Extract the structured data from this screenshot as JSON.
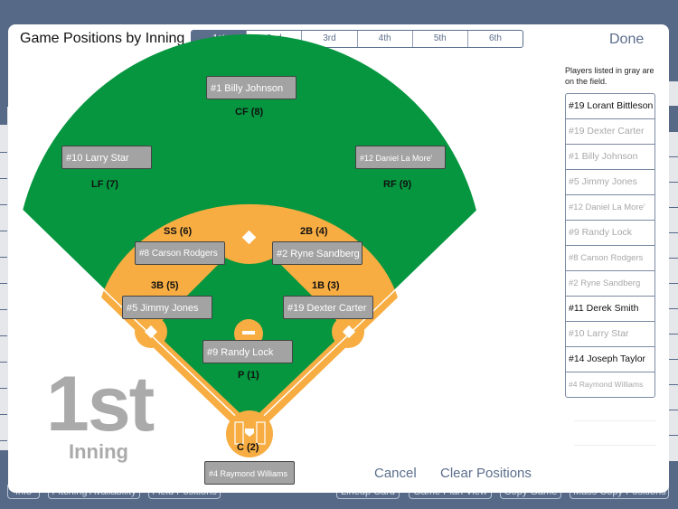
{
  "modal": {
    "title": "Game Positions by Inning",
    "done_label": "Done",
    "cancel_label": "Cancel",
    "clear_label": "Clear Positions"
  },
  "innings": {
    "tabs": [
      "1st",
      "2nd",
      "3rd",
      "4th",
      "5th",
      "6th"
    ],
    "selected": "1st",
    "big_label": "1st",
    "word": "Inning"
  },
  "positions": [
    {
      "key": "cf",
      "label": "CF (8)",
      "player": "#1 Billy Johnson"
    },
    {
      "key": "lf",
      "label": "LF (7)",
      "player": "#10 Larry Star"
    },
    {
      "key": "rf",
      "label": "RF (9)",
      "player": "#12 Daniel La More'"
    },
    {
      "key": "ss",
      "label": "SS (6)",
      "player": "#8 Carson Rodgers"
    },
    {
      "key": "2b",
      "label": "2B (4)",
      "player": "#2 Ryne Sandberg"
    },
    {
      "key": "3b",
      "label": "3B (5)",
      "player": "#5 Jimmy Jones"
    },
    {
      "key": "1b",
      "label": "1B (3)",
      "player": "#19 Dexter Carter"
    },
    {
      "key": "p",
      "label": "P (1)",
      "player": "#9 Randy Lock"
    },
    {
      "key": "c",
      "label": "C (2)",
      "player": "#4 Raymond Williams"
    }
  ],
  "roster": {
    "note": "Players listed in gray are on the field.",
    "players": [
      {
        "name": "#19 Lorant Bittleson",
        "on_field": false
      },
      {
        "name": "#19 Dexter Carter",
        "on_field": true
      },
      {
        "name": "#1 Billy Johnson",
        "on_field": true
      },
      {
        "name": "#5 Jimmy Jones",
        "on_field": true
      },
      {
        "name": "#12 Daniel La More'",
        "on_field": true
      },
      {
        "name": "#9 Randy Lock",
        "on_field": true
      },
      {
        "name": "#8 Carson Rodgers",
        "on_field": true
      },
      {
        "name": "#2 Ryne Sandberg",
        "on_field": true
      },
      {
        "name": "#11 Derek Smith",
        "on_field": false
      },
      {
        "name": "#10 Larry Star",
        "on_field": true
      },
      {
        "name": "#14 Joseph Taylor",
        "on_field": false
      },
      {
        "name": "#4 Raymond Williams",
        "on_field": true
      }
    ]
  },
  "bottom_toolbar": [
    "Info",
    "Pitching Availability",
    "Field Positions",
    "Lineup Card",
    "Game Plan View",
    "Copy Game",
    "Mass Copy Positions"
  ],
  "colors": {
    "chrome": "#566a88",
    "accent": "#5b6e8c",
    "grass": "#05963f",
    "dirt": "#f7ad42",
    "player_box": "#a3a3a3"
  }
}
